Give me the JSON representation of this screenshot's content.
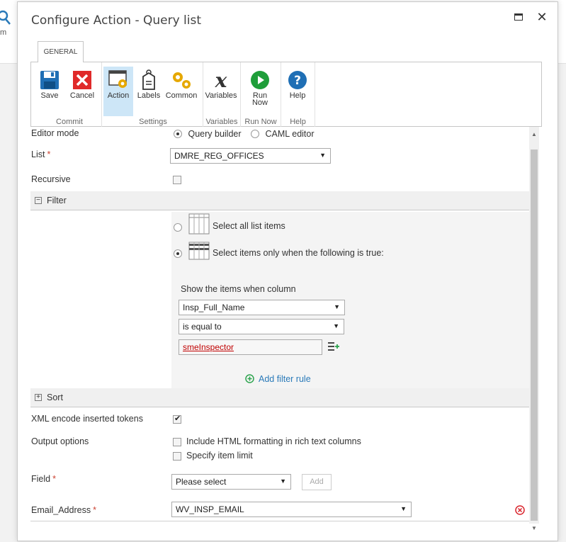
{
  "background": {
    "text": "m"
  },
  "dialog": {
    "title": "Configure Action - Query list"
  },
  "ribbon": {
    "tab": "GENERAL",
    "buttons": {
      "save": "Save",
      "cancel": "Cancel",
      "action": "Action",
      "labels": "Labels",
      "common": "Common",
      "variables": "Variables",
      "run_now": "Run\nNow",
      "help": "Help"
    },
    "groups": {
      "commit": "Commit",
      "settings": "Settings",
      "variables": "Variables",
      "run_now": "Run Now",
      "help": "Help"
    }
  },
  "form": {
    "editor_mode": {
      "label": "Editor mode",
      "options": [
        "Query builder",
        "CAML editor"
      ],
      "selected": "Query builder"
    },
    "list": {
      "label": "List",
      "required": "*",
      "value": "DMRE_REG_OFFICES"
    },
    "recursive": {
      "label": "Recursive",
      "checked": false
    },
    "filter": {
      "title": "Filter",
      "toggle": "−",
      "select_all": "Select all list items",
      "select_when": "Select items only when the following is true:",
      "show_items": "Show the items when column",
      "column": "Insp_Full_Name",
      "operator": "is equal to",
      "value": "smeInspector",
      "add_rule": "Add filter rule"
    },
    "sort": {
      "title": "Sort",
      "toggle": "+"
    },
    "xml_encode": {
      "label": "XML encode inserted tokens",
      "checked": true
    },
    "output_options": {
      "label": "Output options",
      "include_html": "Include HTML formatting in rich text columns",
      "item_limit": "Specify item limit"
    },
    "field": {
      "label": "Field",
      "required": "*",
      "value": "Please select",
      "add": "Add"
    },
    "email": {
      "label": "Email_Address",
      "required": "*",
      "value": "WV_INSP_EMAIL"
    }
  },
  "colors": {
    "accent": "#2a7ab9",
    "active_tab": "#cde6f7",
    "required": "#cc4433",
    "token": "#c00000",
    "add_rule": "#2ea44f",
    "remove": "#d9262e"
  }
}
